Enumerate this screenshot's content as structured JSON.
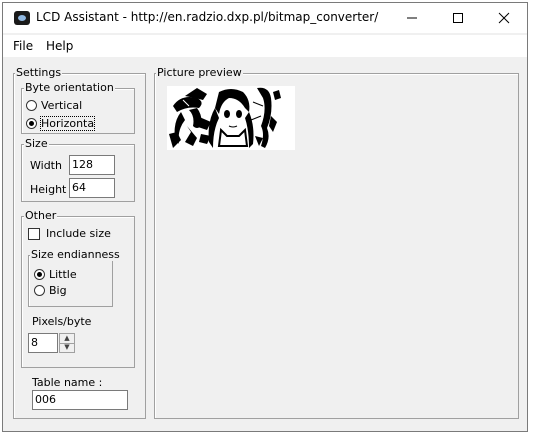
{
  "window": {
    "title": "LCD Assistant -  http://en.radzio.dxp.pl/bitmap_converter/",
    "controls": {
      "minimize": "—",
      "maximize": "☐",
      "close": "✕"
    }
  },
  "menu": {
    "file": "File",
    "help": "Help"
  },
  "settings": {
    "legend": "Settings",
    "byte_orientation": {
      "legend": "Byte orientation",
      "vertical": "Vertical",
      "horizontal": "Horizonta",
      "selected": "horizontal"
    },
    "size": {
      "legend": "Size",
      "width_label": "Width",
      "width_value": "128",
      "height_label": "Height",
      "height_value": "64"
    },
    "other": {
      "legend": "Other",
      "include_size_label": "Include size",
      "include_size_checked": false,
      "size_endianness": {
        "legend": "Size endianness",
        "little": "Little",
        "big": "Big",
        "selected": "little"
      },
      "pixels_per_byte_label": "Pixels/byte",
      "pixels_per_byte_value": "8"
    },
    "table_name_label": "Table name :",
    "table_name_value": "006"
  },
  "preview": {
    "legend": "Picture preview",
    "image_description_icon": "anime-girl-bitmap"
  }
}
